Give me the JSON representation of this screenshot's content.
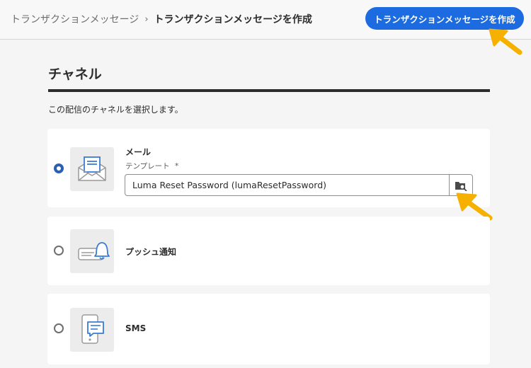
{
  "header": {
    "breadcrumb_parent": "トランザクションメッセージ",
    "breadcrumb_separator": "›",
    "breadcrumb_current": "トランザクションメッセージを作成",
    "create_button_label": "トランザクションメッセージを作成"
  },
  "section": {
    "title": "チャネル",
    "description": "この配信のチャネルを選択します。"
  },
  "channels": [
    {
      "label": "メール",
      "selected": true,
      "icon": "email-envelope-icon",
      "template_label": "テンプレート",
      "required_marker": "*",
      "template_value": "Luma Reset Password (lumaResetPassword)",
      "browse_icon": "folder-search-icon"
    },
    {
      "label": "プッシュ通知",
      "selected": false,
      "icon": "push-bell-icon"
    },
    {
      "label": "SMS",
      "selected": false,
      "icon": "sms-phone-icon"
    }
  ],
  "colors": {
    "accent": "#1c6be0",
    "radio_selected": "#2b5fb4",
    "annotation_arrow": "#f5b000",
    "icon_blue": "#3a7bd5"
  }
}
